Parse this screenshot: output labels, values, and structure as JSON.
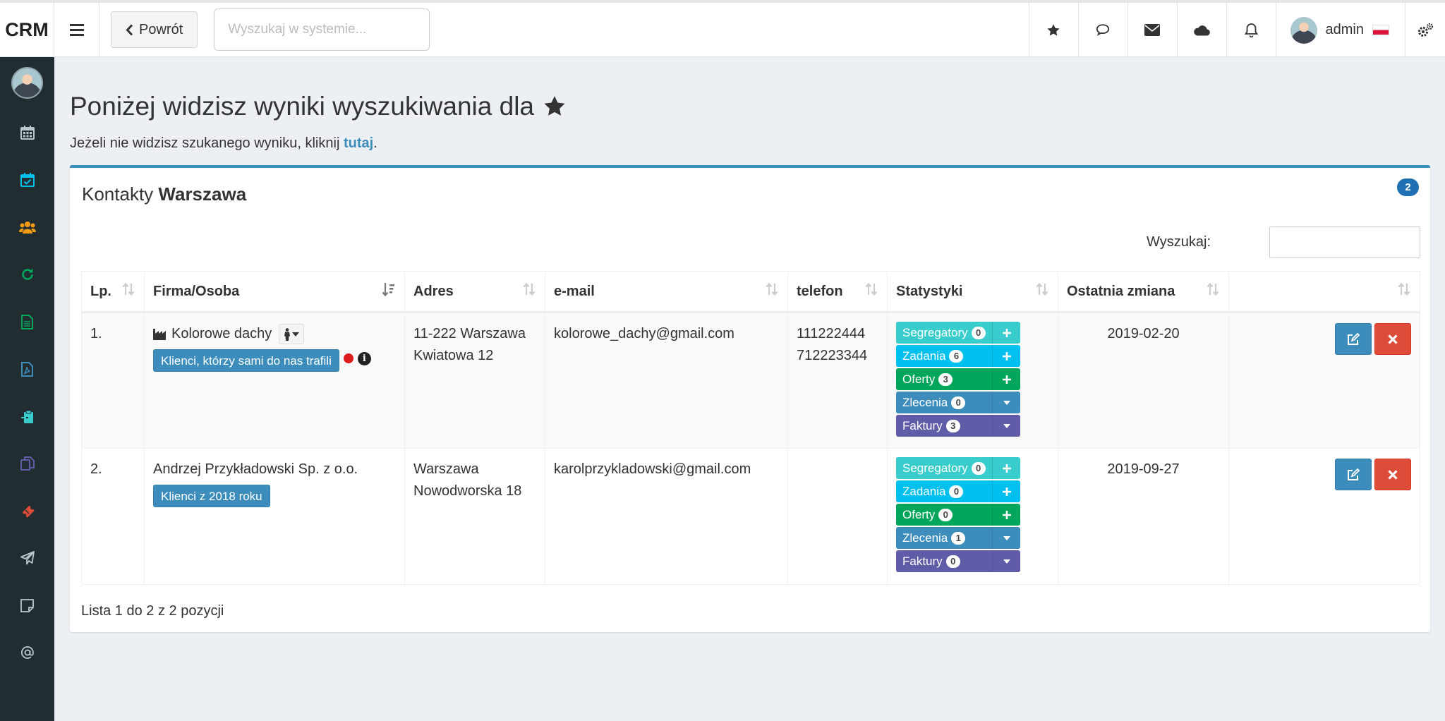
{
  "app": {
    "logo": "CRM"
  },
  "topbar": {
    "back_label": "Powrót",
    "search_placeholder": "Wyszukaj w systemie...",
    "user_name": "admin"
  },
  "page": {
    "title": "Poniżej widzisz wyniki wyszukiwania dla",
    "subline_prefix": "Jeżeli nie widzisz szukanego wyniku, kliknij ",
    "subline_link": "tutaj",
    "subline_suffix": "."
  },
  "box": {
    "title_prefix": "Kontakty",
    "title_bold": "Warszawa",
    "count": "2",
    "search_label": "Wyszukaj:",
    "footer": "Lista 1 do 2 z 2 pozycji"
  },
  "table": {
    "headers": [
      "Lp.",
      "Firma/Osoba",
      "Adres",
      "e-mail",
      "telefon",
      "Statystyki",
      "Ostatnia zmiana",
      ""
    ],
    "rows": [
      {
        "lp": "1.",
        "firm": "Kolorowe dachy",
        "tag": "Klienci, którzy sami do nas trafili",
        "address1": "11-222 Warszawa",
        "address2": "Kwiatowa 12",
        "email": "kolorowe_dachy@gmail.com",
        "phone1": "111222444",
        "phone2": "712223344",
        "stats": {
          "seg": "0",
          "zad": "6",
          "ofe": "3",
          "zle": "0",
          "fak": "3"
        },
        "date": "2019-02-20"
      },
      {
        "lp": "2.",
        "firm": "Andrzej Przykładowski Sp. z o.o.",
        "tag": "Klienci z 2018 roku",
        "address1": "Warszawa",
        "address2": "Nowodworska 18",
        "email": "karolprzykladowski@gmail.com",
        "phone1": "",
        "phone2": "",
        "stats": {
          "seg": "0",
          "zad": "0",
          "ofe": "0",
          "zle": "1",
          "fak": "0"
        },
        "date": "2019-09-27"
      }
    ]
  },
  "stat_labels": {
    "seg": "Segregatory",
    "zad": "Zadania",
    "ofe": "Oferty",
    "zle": "Zlecenia",
    "fak": "Faktury"
  },
  "colors": {
    "primary": "#3c8dbc",
    "danger": "#dd4b39",
    "sidebar": "#222d32",
    "teal": "#39cccc",
    "aqua": "#00c0ef",
    "green": "#00a65a",
    "purple": "#605ca8"
  },
  "icons": {
    "sidebar": [
      "calendar-icon",
      "calendar-check-icon",
      "users-icon",
      "refresh-icon",
      "document-icon",
      "pdf-icon",
      "clipboard-icon",
      "copy-icon",
      "ticket-icon",
      "paper-plane-icon",
      "sticky-note-icon",
      "at-icon"
    ],
    "topbar": [
      "star-icon",
      "comments-icon",
      "envelope-icon",
      "cloud-icon",
      "bell-icon",
      "cogs-icon"
    ]
  }
}
